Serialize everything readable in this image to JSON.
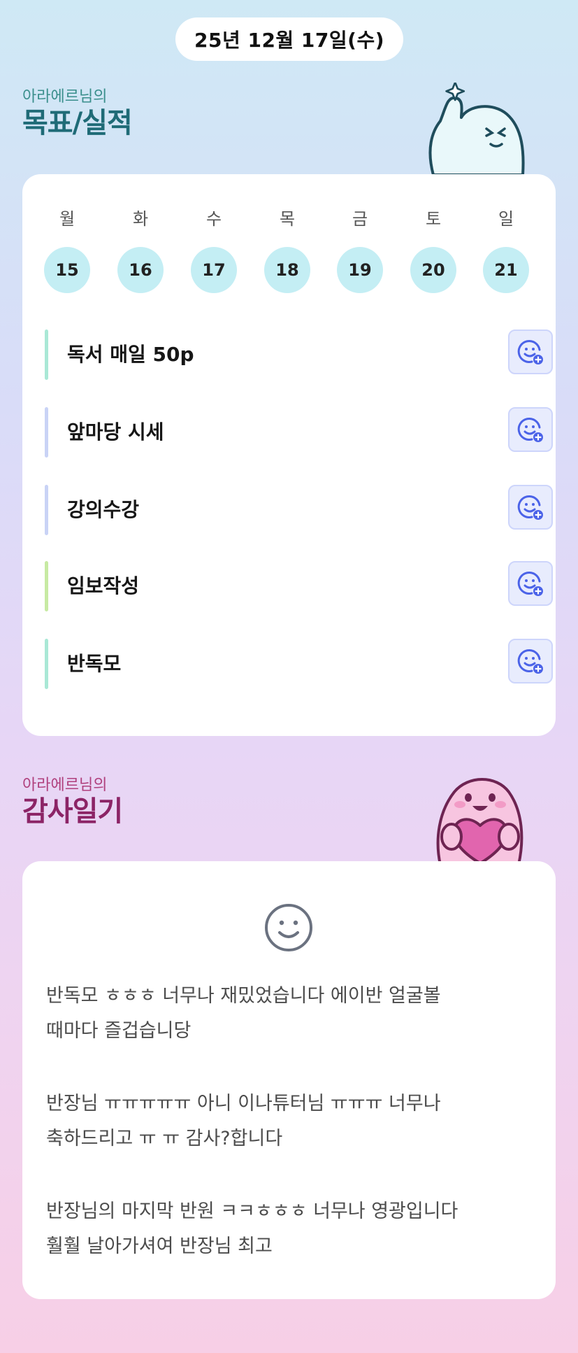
{
  "date": "25년 12월 17일(수)",
  "goals_section": {
    "subtitle": "아라에르님의",
    "title": "목표/실적"
  },
  "week": {
    "days": [
      {
        "label": "월",
        "num": "15"
      },
      {
        "label": "화",
        "num": "16"
      },
      {
        "label": "수",
        "num": "17"
      },
      {
        "label": "목",
        "num": "18"
      },
      {
        "label": "금",
        "num": "19"
      },
      {
        "label": "토",
        "num": "20"
      },
      {
        "label": "일",
        "num": "21"
      }
    ]
  },
  "goals": [
    {
      "text": "독서 매일 50p",
      "bar_color": "#a9e8d6"
    },
    {
      "text": "앞마당 시세",
      "bar_color": "#c9d3f6"
    },
    {
      "text": "강의수강",
      "bar_color": "#c9d3f6"
    },
    {
      "text": "임보작성",
      "bar_color": "#c7eaa3"
    },
    {
      "text": "반독모",
      "bar_color": "#a9e8d6"
    }
  ],
  "gratitude_section": {
    "subtitle": "아라에르님의",
    "title": "감사일기",
    "paragraphs": [
      {
        "line1": "반독모 ㅎㅎㅎ 너무나 재밌었습니다 에이반 얼굴볼",
        "line2": "때마다 즐겁습니당"
      },
      {
        "line1": "반장님 ㅠㅠㅠㅠㅠ 아니 이나튜터님 ㅠㅠㅠ 너무나",
        "line2": "축하드리고 ㅠ ㅠ 감사?합니다"
      },
      {
        "line1": "반장님의 마지막 반원 ㅋㅋㅎㅎㅎ 너무나 영광입니다",
        "line2": "훨훨 날아가셔여 반장님 최고"
      }
    ]
  },
  "colors": {
    "accent_teal": "#1f6b77",
    "accent_magenta": "#8c2466",
    "day_circle": "#c4eef4",
    "react_icon": "#4b63e8"
  },
  "icons": {
    "goal_action": "smiley-plus-icon",
    "gratitude_mood": "smiley-icon"
  }
}
